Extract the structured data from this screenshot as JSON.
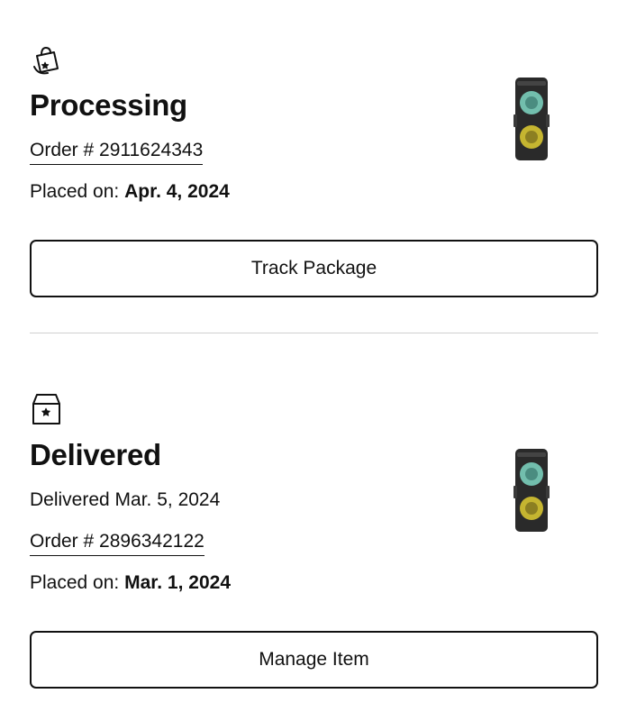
{
  "orders": [
    {
      "status_icon": "shopping-bag-star-icon",
      "status": "Processing",
      "delivered_note": "",
      "order_label": "Order # 2911624343",
      "placed_label": "Placed on: ",
      "placed_date": "Apr. 4, 2024",
      "action_label": "Track Package",
      "thumbnail_icon": "party-speaker-thumbnail"
    },
    {
      "status_icon": "box-star-icon",
      "status": "Delivered",
      "delivered_note": "Delivered Mar. 5, 2024",
      "order_label": "Order # 2896342122",
      "placed_label": "Placed on: ",
      "placed_date": "Mar. 1, 2024",
      "action_label": "Manage Item",
      "thumbnail_icon": "party-speaker-thumbnail"
    }
  ],
  "colors": {
    "text": "#111111",
    "divider": "#cfcfcf",
    "speaker_body": "#2a2a2a",
    "speaker_glow_top": "#7fd8c4",
    "speaker_glow_bottom": "#d6c431"
  }
}
